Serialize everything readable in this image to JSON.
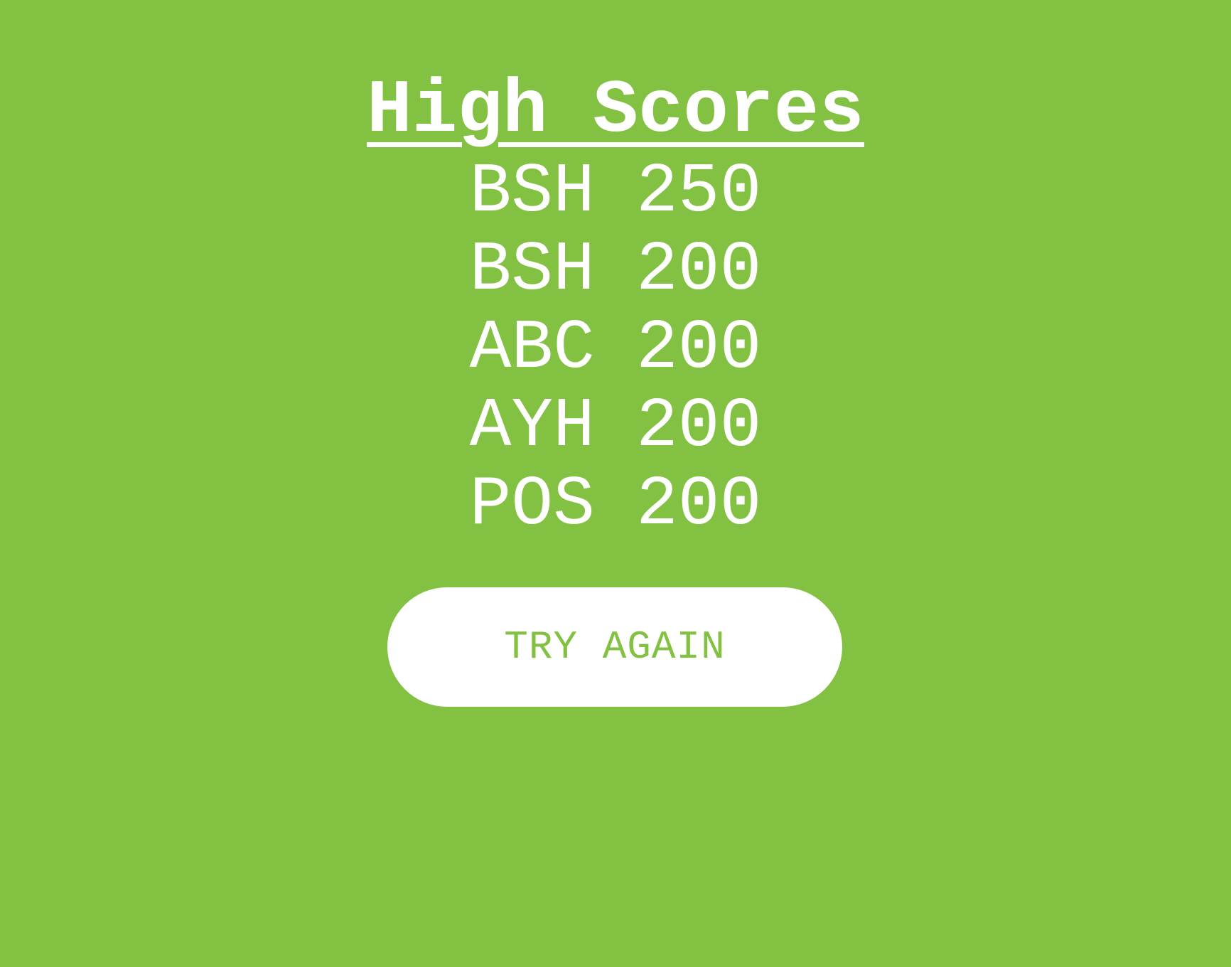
{
  "colors": {
    "background": "#82c141",
    "text": "#ffffff",
    "button_background": "#ffffff",
    "button_text": "#82c141"
  },
  "high_scores": {
    "title": "High Scores",
    "entries": [
      {
        "initials": "BSH",
        "score": "250"
      },
      {
        "initials": "BSH",
        "score": "200"
      },
      {
        "initials": "ABC",
        "score": "200"
      },
      {
        "initials": "AYH",
        "score": "200"
      },
      {
        "initials": "POS",
        "score": "200"
      }
    ]
  },
  "actions": {
    "try_again_label": "TRY AGAIN"
  }
}
